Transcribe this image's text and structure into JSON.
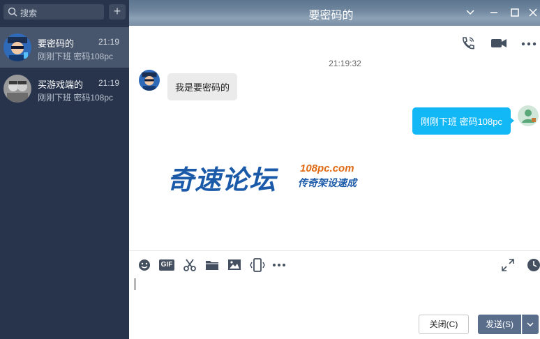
{
  "colors": {
    "sidebar_bg": "#27344c",
    "active_item_bg": "#48566d",
    "bubble_sent": "#12b7f5",
    "bubble_received": "#ebebeb",
    "send_button": "#5a6e8c"
  },
  "sidebar": {
    "search": {
      "placeholder": "搜索"
    },
    "add_icon": "plus-icon",
    "contacts": [
      {
        "name": "要密码的",
        "time": "21:19",
        "preview": "刚刚下班  密码108pc",
        "active": true
      },
      {
        "name": "买游戏端的",
        "time": "21:19",
        "preview": "刚刚下班  密码108pc",
        "active": false
      }
    ]
  },
  "window": {
    "title": "要密码的",
    "controls": [
      "chevron-down-icon",
      "minimize-icon",
      "maximize-icon",
      "close-icon"
    ]
  },
  "chat": {
    "header_icons": [
      "phone-call-icon",
      "video-call-icon",
      "more-icon"
    ],
    "timestamp": "21:19:32",
    "messages": [
      {
        "side": "left",
        "text": "我是要密码的"
      },
      {
        "side": "right",
        "text": "刚刚下班  密码108pc"
      }
    ],
    "watermark": {
      "main": "奇速论坛",
      "url": "108pc.com",
      "sub": "传奇架设速成"
    }
  },
  "toolbar": {
    "tools": [
      "emoji-icon",
      "gif-icon",
      "scissors-icon",
      "folder-icon",
      "image-icon",
      "shake-icon",
      "more-icon"
    ],
    "gif_label": "GIF",
    "right_tools": [
      "expand-icon",
      "history-icon"
    ]
  },
  "input": {
    "close_label": "关闭(C)",
    "send_label": "发送(S)"
  }
}
